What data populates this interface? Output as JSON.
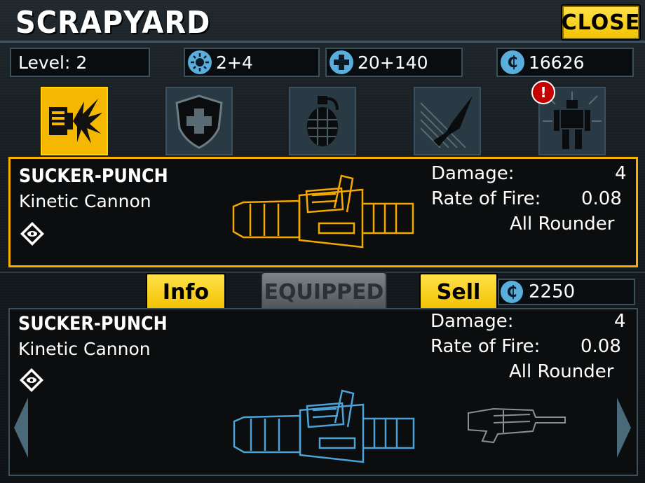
{
  "header": {
    "title": "Scrapyard",
    "close_label": "Close"
  },
  "stats": {
    "level": "Level: 2",
    "slots": "2+4",
    "health": "20+140",
    "credits": "16626"
  },
  "tabs": [
    {
      "name": "weapons",
      "active": true
    },
    {
      "name": "armor",
      "active": false
    },
    {
      "name": "grenades",
      "active": false
    },
    {
      "name": "missiles",
      "active": false
    },
    {
      "name": "robots",
      "active": false,
      "alert": "!"
    }
  ],
  "selected": {
    "name": "Sucker-Punch",
    "type": "Kinetic Cannon",
    "damage_label": "Damage:",
    "damage": "4",
    "rof_label": "Rate of Fire:",
    "rof": "0.08",
    "role": "All Rounder"
  },
  "actions": {
    "info_label": "Info",
    "equipped_label": "Equipped",
    "sell_label": "Sell",
    "sell_price": "2250"
  },
  "item": {
    "name": "Sucker-Punch",
    "type": "Kinetic Cannon",
    "damage_label": "Damage:",
    "damage": "4",
    "rof_label": "Rate of Fire:",
    "rof": "0.08",
    "role": "All Rounder"
  },
  "colors": {
    "accent": "#f5b800",
    "blueprint": "#4aa3d8",
    "panel_border": "#3a4f5a"
  }
}
